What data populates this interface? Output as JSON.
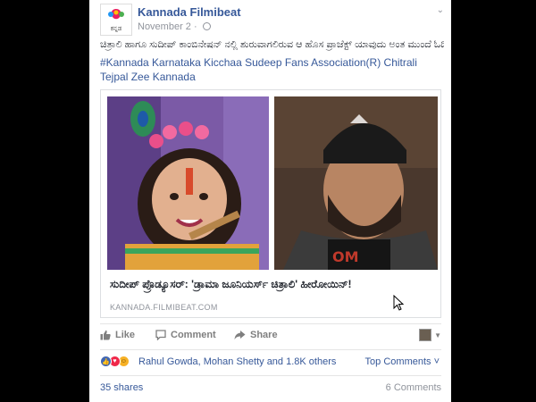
{
  "post": {
    "page_name": "Kannada Filmibeat",
    "date": "November 2",
    "logo_text": "ಕನ್ನಡ",
    "text": "ಚಿತ್ರಾಲಿ ಹಾಗೂ ಸುದೀಪ್ ಕಾಂಬಿನೇಷನ್ ನಲ್ಲಿ ಶುರುವಾಗಲಿರುವ ಆ ಹೊಸ ಪ್ರಾಜೆಕ್ಟ್ ಯಾವುದು ಅಂತ ಮುಂದೆ ಓದಿ....",
    "hashtags": "#Kannada Karnataka Kicchaa Sudeep Fans Association(R) Chitrali Tejpal Zee Kannada"
  },
  "link": {
    "title": "ಸುದೀಪ್ ಪ್ರೊಡ್ಯೂಸರ್: 'ಡ್ರಾಮಾ ಜೂನಿಯರ್ಸ್ ಚಿತ್ರಾಲಿ' ಹೀರೋಯಿನ್!",
    "domain": "KANNADA.FILMIBEAT.COM"
  },
  "actions": {
    "like": "Like",
    "comment": "Comment",
    "share": "Share"
  },
  "reactions": {
    "names": "Rahul Gowda, Mohan Shetty and 1.8K others",
    "top_comments": "Top Comments ˅",
    "colors": {
      "like": "#4267b2",
      "love": "#f0284a",
      "haha": "#f7b125"
    }
  },
  "stats": {
    "shares": "35 shares",
    "comments": "6 Comments"
  },
  "colors": {
    "link": "#365899",
    "muted": "#90949c",
    "text": "#1d2129"
  }
}
